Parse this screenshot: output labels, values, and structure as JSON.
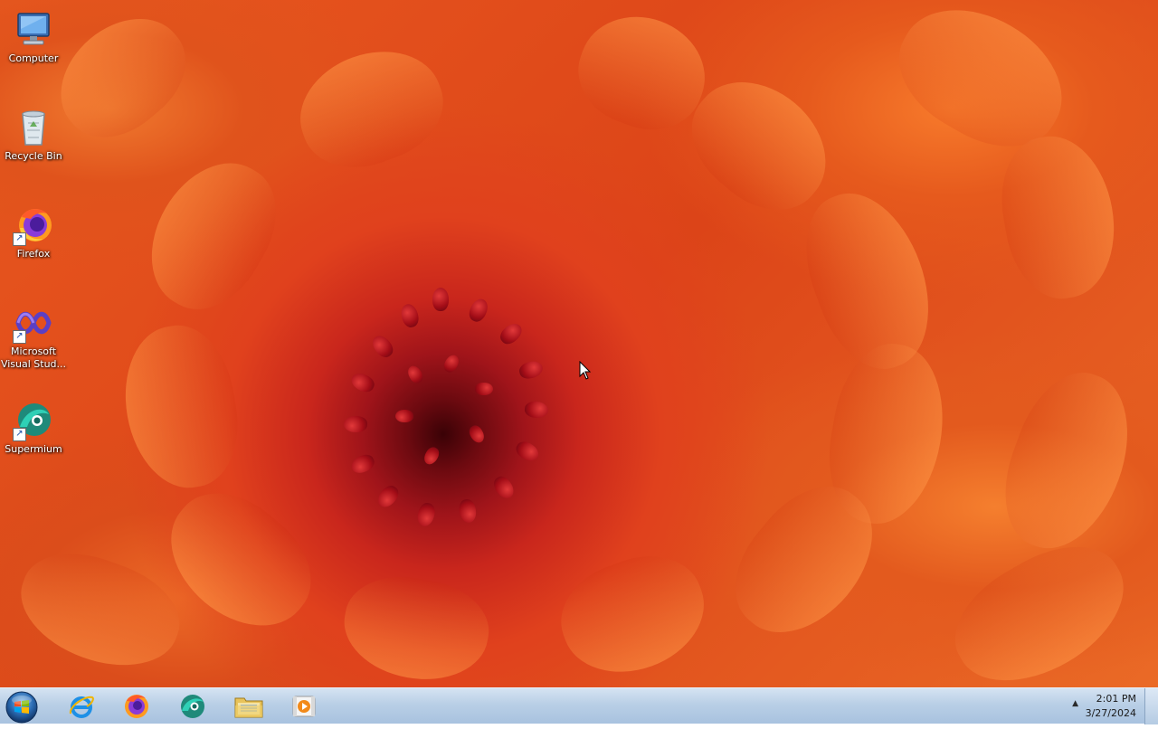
{
  "desktop": {
    "icons": [
      {
        "label": "Computer",
        "icon": "computer-icon"
      },
      {
        "label": "Recycle Bin",
        "icon": "recycle-bin-icon"
      },
      {
        "label": "Firefox",
        "icon": "firefox-icon"
      },
      {
        "label": "Microsoft\nVisual Stud...",
        "icon": "visual-studio-icon"
      },
      {
        "label": "Supermium",
        "icon": "supermium-icon"
      }
    ]
  },
  "taskbar": {
    "pinned": [
      {
        "name": "Internet Explorer",
        "icon": "internet-explorer-icon"
      },
      {
        "name": "Firefox",
        "icon": "firefox-icon"
      },
      {
        "name": "Supermium",
        "icon": "supermium-icon"
      },
      {
        "name": "Windows Explorer",
        "icon": "folder-icon"
      },
      {
        "name": "Media Player",
        "icon": "media-player-icon"
      }
    ],
    "clock": {
      "time": "2:01 PM",
      "date": "3/27/2024"
    },
    "tray_arrow": "▲"
  },
  "colors": {
    "taskbar_top": "#d5e3f2",
    "taskbar_bottom": "#a8c2df",
    "wallpaper_center": "#3a0206",
    "wallpaper_orange": "#e8581f"
  }
}
